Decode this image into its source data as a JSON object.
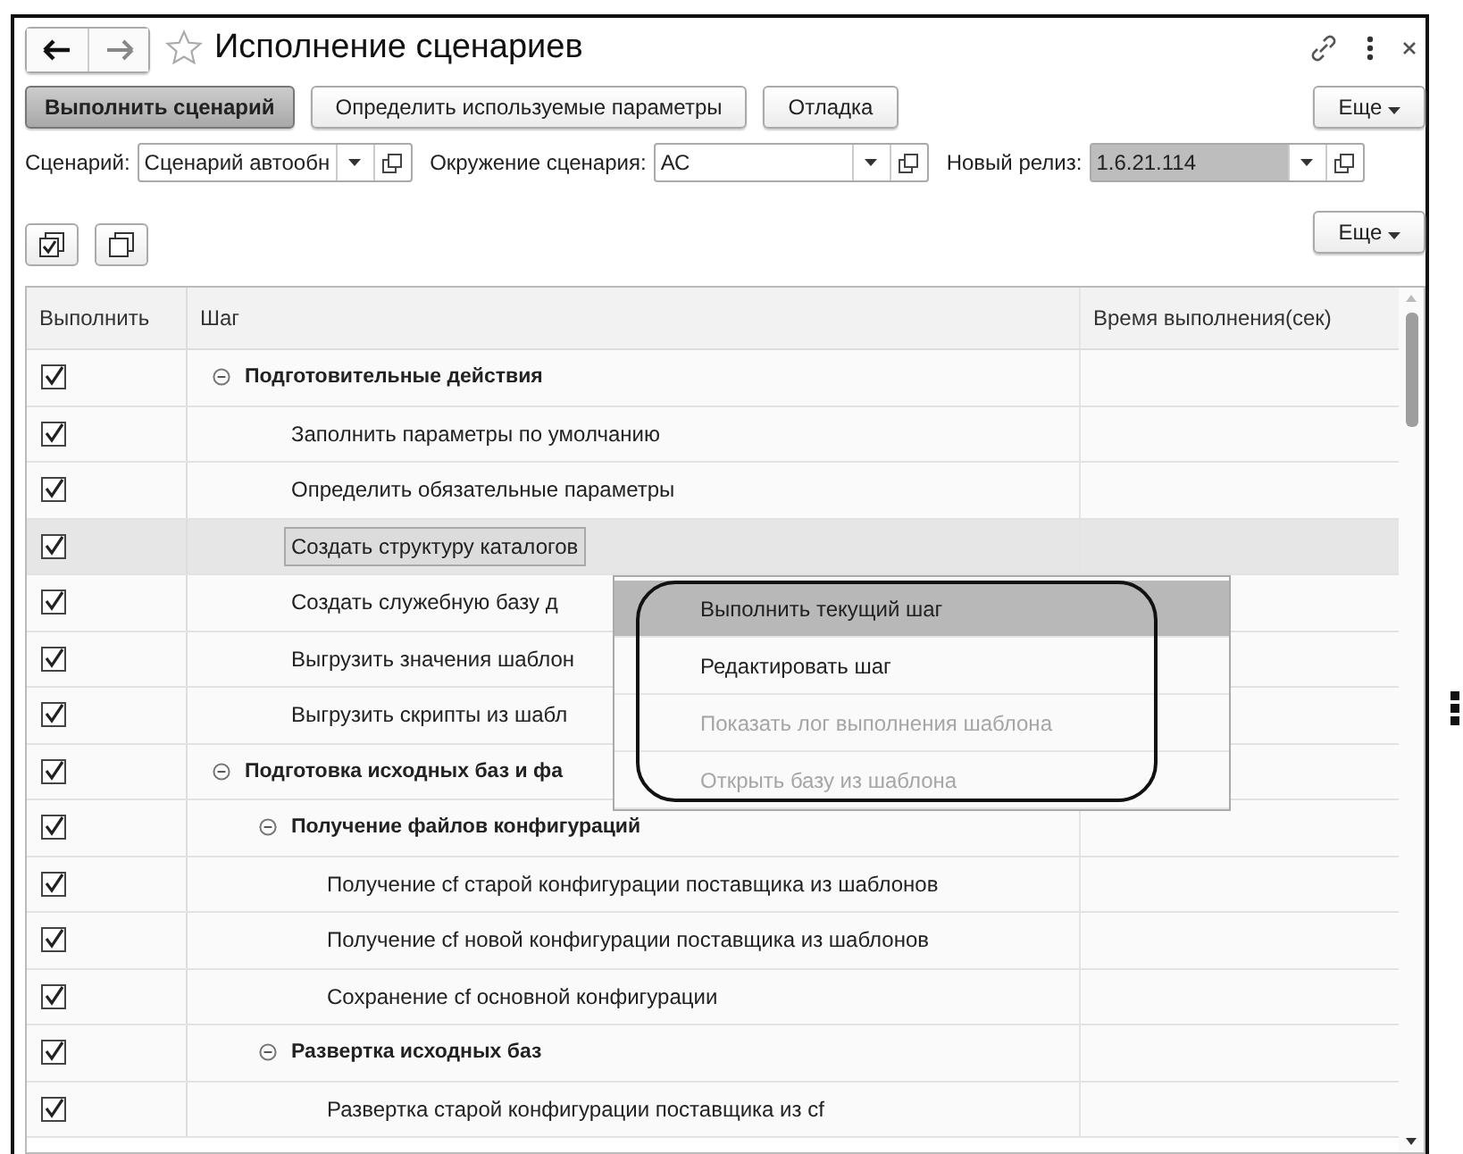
{
  "window": {
    "title": "Исполнение сценариев",
    "favorite": false
  },
  "toolbar": {
    "buttons": [
      {
        "label": "Выполнить сценарий",
        "kind": "primary"
      },
      {
        "label": "Определить используемые параметры",
        "kind": "normal"
      },
      {
        "label": "Отладка",
        "kind": "normal"
      }
    ],
    "more": "Еще"
  },
  "fields": [
    {
      "label": "Сценарий:",
      "value": "Сценарий автообн",
      "disabled": false,
      "kind": "narrow"
    },
    {
      "label": "Окружение сценария:",
      "value": "АС",
      "disabled": false,
      "kind": "wide"
    },
    {
      "label": "Новый релиз:",
      "value": "1.6.21.114",
      "disabled": true,
      "kind": "wide"
    }
  ],
  "table_toolbar": {
    "more": "Еще"
  },
  "table": {
    "columns": [
      "Выполнить",
      "Шаг",
      "Время выполнения(сек)"
    ],
    "rows": [
      {
        "checked": true,
        "step": "Подготовительные действия",
        "expanded": true,
        "selected": false,
        "children": [
          {
            "checked": true,
            "step": "Заполнить параметры по умолчанию",
            "selected": false
          },
          {
            "checked": true,
            "step": "Определить обязательные параметры",
            "selected": false
          },
          {
            "checked": true,
            "step": "Создать структуру каталогов",
            "selected": true
          },
          {
            "checked": true,
            "step": "Создать служебную базу д",
            "selected": false
          },
          {
            "checked": true,
            "step": "Выгрузить значения шаблон",
            "selected": false
          },
          {
            "checked": true,
            "step": "Выгрузить скрипты из шабл",
            "selected": false
          }
        ]
      },
      {
        "checked": true,
        "step": "Подготовка исходных баз и фа",
        "expanded": true,
        "selected": false,
        "children": [
          {
            "checked": true,
            "step": "Получение файлов конфигураций",
            "expanded": true,
            "selected": false,
            "children": [
              {
                "checked": true,
                "step": "Получение cf старой конфигурации поставщика из шаблонов",
                "selected": false
              },
              {
                "checked": true,
                "step": "Получение cf новой конфигурации поставщика из шаблонов",
                "selected": false
              },
              {
                "checked": true,
                "step": "Сохранение cf основной конфигурации",
                "selected": false
              }
            ]
          },
          {
            "checked": true,
            "step": "Развертка исходных баз",
            "expanded": true,
            "selected": false,
            "children": [
              {
                "checked": true,
                "step": "Развертка старой конфигурации поставщика из cf",
                "selected": false
              }
            ]
          }
        ]
      }
    ]
  },
  "context_menu": {
    "items": [
      {
        "label": "Выполнить текущий шаг",
        "selected": true,
        "disabled": false
      },
      {
        "label": "Редактировать шаг",
        "selected": false,
        "disabled": false
      },
      {
        "label": "Показать лог выполнения шаблона",
        "selected": false,
        "disabled": true
      },
      {
        "label": "Открыть базу из шаблона",
        "selected": false,
        "disabled": true
      }
    ]
  }
}
